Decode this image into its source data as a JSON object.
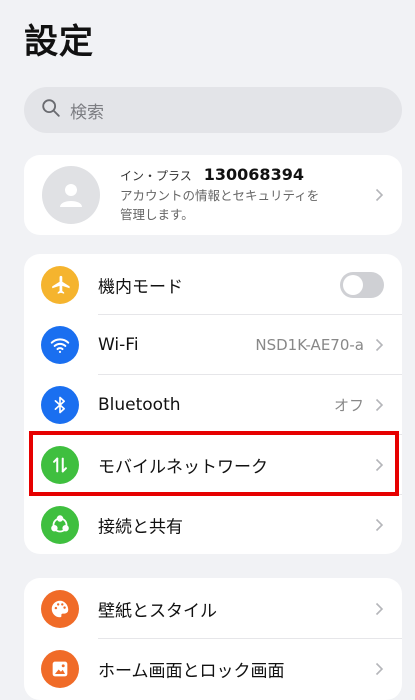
{
  "header": {
    "title": "設定"
  },
  "search": {
    "placeholder": "検索"
  },
  "account": {
    "name": "イン・プラス",
    "id": "130068394",
    "desc_line1": "アカウントの情報とセキュリティを",
    "desc_line2": "管理します。"
  },
  "group1": {
    "airplane": {
      "label": "機内モード",
      "toggle_on": false,
      "color": "#f5b42e"
    },
    "wifi": {
      "label": "Wi-Fi",
      "value": "NSD1K-AE70-a",
      "color": "#1a6ff0"
    },
    "bluetooth": {
      "label": "Bluetooth",
      "value": "オフ",
      "color": "#1a6ff0"
    },
    "mobile": {
      "label": "モバイルネットワーク",
      "color": "#3fbf3f"
    },
    "connect": {
      "label": "接続と共有",
      "color": "#3fbf3f"
    }
  },
  "group2": {
    "wallpaper": {
      "label": "壁紙とスタイル",
      "color": "#f06b28"
    },
    "home": {
      "label": "ホーム画面とロック画面",
      "color": "#f06b28"
    }
  },
  "annotation": {
    "highlight_color": "#e60000"
  }
}
